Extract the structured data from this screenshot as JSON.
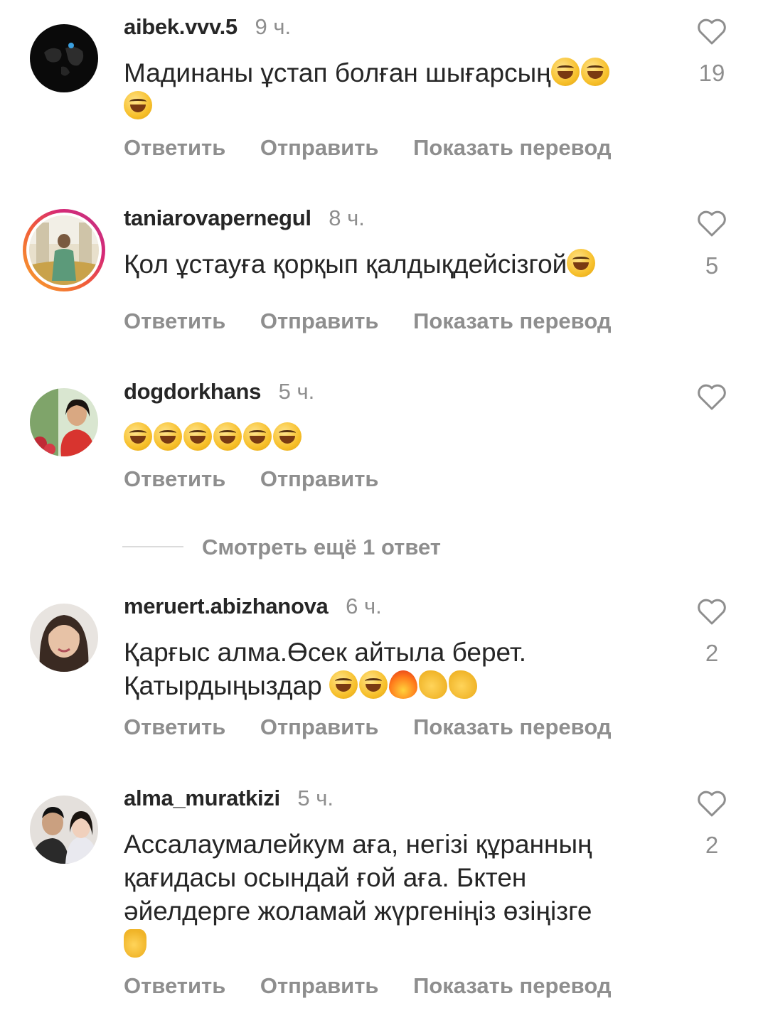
{
  "comments": [
    {
      "username": "aibek.vvv.5",
      "time": "9 ч.",
      "text_line1": "Мадинаны ұстап болған шығарсың",
      "likes": "19",
      "reply": "Ответить",
      "send": "Отправить",
      "translate": "Показать перевод"
    },
    {
      "username": "taniarovapernegul",
      "time": "8 ч.",
      "text_line1": "Қол ұстауға қорқып қалдықдейсізгой",
      "likes": "5",
      "reply": "Ответить",
      "send": "Отправить",
      "translate": "Показать перевод"
    },
    {
      "username": "dogdorkhans",
      "time": "5 ч.",
      "text_line1": "",
      "reply": "Ответить",
      "send": "Отправить"
    },
    {
      "username": "meruert.abizhanova",
      "time": "6 ч.",
      "text_line1": "Қарғыс алма.Өсек айтыла берет.",
      "text_line2": "Қатырдыңыздар ",
      "likes": "2",
      "reply": "Ответить",
      "send": "Отправить",
      "translate": "Показать перевод"
    },
    {
      "username": "alma_muratkizi",
      "time": "5 ч.",
      "text_line1": "Ассалаумалейкум  аға, негізі құранның",
      "text_line2": "қағидасы осындай ғой аға. Бктен",
      "text_line3": "әйелдерге жоламай жүргеніңіз өзіңізге",
      "likes": "2",
      "reply": "Ответить",
      "send": "Отправить",
      "translate": "Показать перевод"
    }
  ],
  "view_more_replies": "Смотреть ещё 1 ответ",
  "colors": {
    "text": "#262626",
    "secondary": "#8e8e8e",
    "divider": "#dbdbdb"
  },
  "icons": {
    "like": "heart-outline-icon"
  }
}
